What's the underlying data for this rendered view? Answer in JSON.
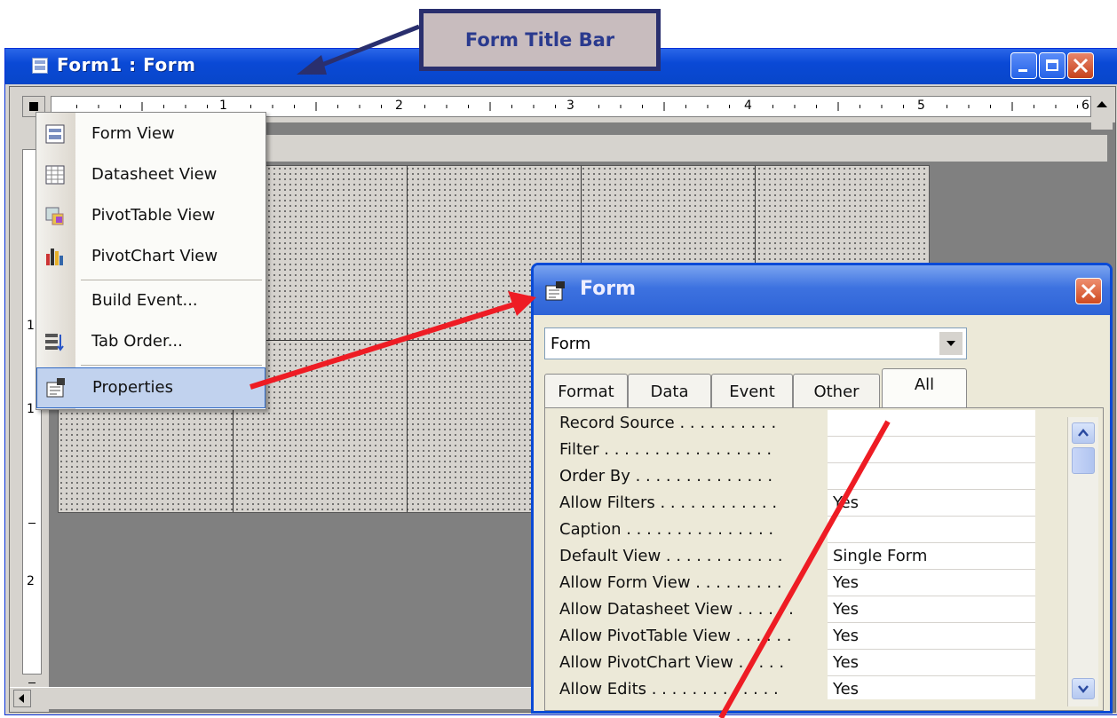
{
  "callout": {
    "label": "Form Title Bar"
  },
  "window": {
    "title": "Form1 : Form",
    "buttons": {
      "minimize": "minimize-icon",
      "maximize": "maximize-icon",
      "close": "close-icon"
    }
  },
  "ruler": {
    "top_numbers": [
      "1",
      "2",
      "3",
      "4",
      "5",
      "6"
    ],
    "left_numbers": [
      "1",
      "1",
      "2"
    ]
  },
  "context_menu": {
    "items": [
      {
        "label": "Form View",
        "icon": "form-view-icon"
      },
      {
        "label": "Datasheet View",
        "icon": "datasheet-view-icon"
      },
      {
        "label": "PivotTable View",
        "icon": "pivottable-view-icon"
      },
      {
        "label": "PivotChart View",
        "icon": "pivotchart-view-icon"
      },
      {
        "label": "Build Event...",
        "icon": ""
      },
      {
        "label": "Tab Order...",
        "icon": "tab-order-icon"
      },
      {
        "label": "Properties",
        "icon": "properties-icon"
      }
    ],
    "highlighted": "Properties"
  },
  "properties_dialog": {
    "title": "Form",
    "object_select": {
      "value": "Form"
    },
    "tabs": [
      "Format",
      "Data",
      "Event",
      "Other",
      "All"
    ],
    "active_tab": "All",
    "rows": [
      {
        "name": "Record Source . . . . . . . . . .",
        "value": ""
      },
      {
        "name": "Filter . . . . . . . . . . . . . . . . .",
        "value": ""
      },
      {
        "name": "Order By . . . . . . . . . . . . . .",
        "value": ""
      },
      {
        "name": "Allow Filters . . . . . . . . . . . .",
        "value": "Yes"
      },
      {
        "name": "Caption . . . . . . . . . . . . . . .",
        "value": ""
      },
      {
        "name": "Default View . . . . . . . . . . . .",
        "value": "Single Form"
      },
      {
        "name": "Allow Form View . . . . . . . . .",
        "value": "Yes"
      },
      {
        "name": "Allow Datasheet View . . . . . .",
        "value": "Yes"
      },
      {
        "name": "Allow PivotTable View . . . . . .",
        "value": "Yes"
      },
      {
        "name": "Allow PivotChart View . . . . .",
        "value": "Yes"
      },
      {
        "name": "Allow Edits . . . . . . . . . . . . .",
        "value": "Yes"
      }
    ]
  },
  "colors": {
    "accent": "#0a49d6",
    "arrow_red": "#ee1c24",
    "callout_border": "#2a2f6e"
  }
}
